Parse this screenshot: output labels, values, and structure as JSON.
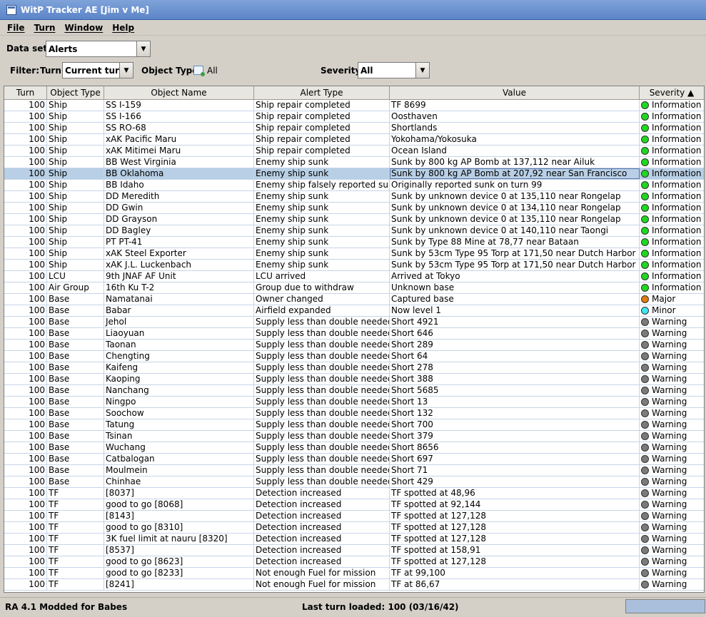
{
  "window": {
    "title": "WitP Tracker AE [Jim v Me]"
  },
  "menu": [
    "File",
    "Turn",
    "Window",
    "Help"
  ],
  "filters": {
    "dataset_label": "Data set:",
    "dataset_value": "Alerts",
    "filter_label": "Filter:",
    "turn_label": "Turn:",
    "turn_value": "Current turn",
    "object_type_label": "Object Type:",
    "object_type_value": "All",
    "severity_label": "Severity:",
    "severity_value": "All"
  },
  "table": {
    "columns": [
      "Turn",
      "Object Type",
      "Object Name",
      "Alert Type",
      "Value",
      "Severity ▲"
    ],
    "severity_colors": {
      "Information": "#1fd81f",
      "Major": "#e07b10",
      "Minor": "#3ee6f0",
      "Warning": "#7b7b7b"
    },
    "rows": [
      [
        "100",
        "Ship",
        "SS I-159",
        "Ship repair completed",
        "TF 8699",
        "Information"
      ],
      [
        "100",
        "Ship",
        "SS I-166",
        "Ship repair completed",
        "Oosthaven",
        "Information"
      ],
      [
        "100",
        "Ship",
        "SS RO-68",
        "Ship repair completed",
        "Shortlands",
        "Information"
      ],
      [
        "100",
        "Ship",
        "xAK Pacific Maru",
        "Ship repair completed",
        "Yokohama/Yokosuka",
        "Information"
      ],
      [
        "100",
        "Ship",
        "xAK Mitimei Maru",
        "Ship repair completed",
        "Ocean Island",
        "Information"
      ],
      [
        "100",
        "Ship",
        "BB West Virginia",
        "Enemy ship sunk",
        "Sunk by 800 kg AP Bomb at 137,112 near Ailuk",
        "Information"
      ],
      [
        "100",
        "Ship",
        "BB Oklahoma",
        "Enemy ship sunk",
        "Sunk by 800 kg AP Bomb at 207,92 near San Francisco",
        "Information"
      ],
      [
        "100",
        "Ship",
        "BB Idaho",
        "Enemy ship falsely reported sunk",
        "Originally reported sunk on turn 99",
        "Information"
      ],
      [
        "100",
        "Ship",
        "DD Meredith",
        "Enemy ship sunk",
        "Sunk by unknown device 0 at 135,110 near Rongelap",
        "Information"
      ],
      [
        "100",
        "Ship",
        "DD Gwin",
        "Enemy ship sunk",
        "Sunk by unknown device 0 at 134,110 near Rongelap",
        "Information"
      ],
      [
        "100",
        "Ship",
        "DD Grayson",
        "Enemy ship sunk",
        "Sunk by unknown device 0 at 135,110 near Rongelap",
        "Information"
      ],
      [
        "100",
        "Ship",
        "DD Bagley",
        "Enemy ship sunk",
        "Sunk by unknown device 0 at 140,110 near Taongi",
        "Information"
      ],
      [
        "100",
        "Ship",
        "PT PT-41",
        "Enemy ship sunk",
        "Sunk by Type 88 Mine at 78,77 near Bataan",
        "Information"
      ],
      [
        "100",
        "Ship",
        "xAK Steel Exporter",
        "Enemy ship sunk",
        "Sunk by 53cm Type 95 Torp at 171,50 near Dutch Harbor",
        "Information"
      ],
      [
        "100",
        "Ship",
        "xAK J.L. Luckenbach",
        "Enemy ship sunk",
        "Sunk by 53cm Type 95 Torp at 171,50 near Dutch Harbor",
        "Information"
      ],
      [
        "100",
        "LCU",
        "9th JNAF AF Unit",
        "LCU arrived",
        "Arrived at Tokyo",
        "Information"
      ],
      [
        "100",
        "Air Group",
        "16th Ku T-2",
        "Group due to withdraw",
        "Unknown base",
        "Information"
      ],
      [
        "100",
        "Base",
        "Namatanai",
        "Owner changed",
        "Captured base",
        "Major"
      ],
      [
        "100",
        "Base",
        "Babar",
        "Airfield expanded",
        "Now level 1",
        "Minor"
      ],
      [
        "100",
        "Base",
        "Jehol",
        "Supply less than double needed",
        "Short 4921",
        "Warning"
      ],
      [
        "100",
        "Base",
        "Liaoyuan",
        "Supply less than double needed",
        "Short 646",
        "Warning"
      ],
      [
        "100",
        "Base",
        "Taonan",
        "Supply less than double needed",
        "Short 289",
        "Warning"
      ],
      [
        "100",
        "Base",
        "Chengting",
        "Supply less than double needed",
        "Short 64",
        "Warning"
      ],
      [
        "100",
        "Base",
        "Kaifeng",
        "Supply less than double needed",
        "Short 278",
        "Warning"
      ],
      [
        "100",
        "Base",
        "Kaoping",
        "Supply less than double needed",
        "Short 388",
        "Warning"
      ],
      [
        "100",
        "Base",
        "Nanchang",
        "Supply less than double needed",
        "Short 5685",
        "Warning"
      ],
      [
        "100",
        "Base",
        "Ningpo",
        "Supply less than double needed",
        "Short 13",
        "Warning"
      ],
      [
        "100",
        "Base",
        "Soochow",
        "Supply less than double needed",
        "Short 132",
        "Warning"
      ],
      [
        "100",
        "Base",
        "Tatung",
        "Supply less than double needed",
        "Short 700",
        "Warning"
      ],
      [
        "100",
        "Base",
        "Tsinan",
        "Supply less than double needed",
        "Short 379",
        "Warning"
      ],
      [
        "100",
        "Base",
        "Wuchang",
        "Supply less than double needed",
        "Short 8656",
        "Warning"
      ],
      [
        "100",
        "Base",
        "Catbalogan",
        "Supply less than double needed",
        "Short 697",
        "Warning"
      ],
      [
        "100",
        "Base",
        "Moulmein",
        "Supply less than double needed",
        "Short 71",
        "Warning"
      ],
      [
        "100",
        "Base",
        "Chinhae",
        "Supply less than double needed",
        "Short 429",
        "Warning"
      ],
      [
        "100",
        "TF",
        " [8037]",
        "Detection increased",
        "TF spotted at 48,96",
        "Warning"
      ],
      [
        "100",
        "TF",
        "good to go [8068]",
        "Detection increased",
        "TF spotted at 92,144",
        "Warning"
      ],
      [
        "100",
        "TF",
        " [8143]",
        "Detection increased",
        "TF spotted at 127,128",
        "Warning"
      ],
      [
        "100",
        "TF",
        "good to go [8310]",
        "Detection increased",
        "TF spotted at 127,128",
        "Warning"
      ],
      [
        "100",
        "TF",
        "3K fuel limit at nauru [8320]",
        "Detection increased",
        "TF spotted at 127,128",
        "Warning"
      ],
      [
        "100",
        "TF",
        " [8537]",
        "Detection increased",
        "TF spotted at 158,91",
        "Warning"
      ],
      [
        "100",
        "TF",
        "good to go [8623]",
        "Detection increased",
        "TF spotted at 127,128",
        "Warning"
      ],
      [
        "100",
        "TF",
        "good to go [8233]",
        "Not enough Fuel for mission",
        "TF at 99,100",
        "Warning"
      ],
      [
        "100",
        "TF",
        " [8241]",
        "Not enough Fuel for mission",
        "TF at 86,67",
        "Warning"
      ]
    ],
    "selected_row": 6
  },
  "status": {
    "left": "RA 4.1 Modded for Babes",
    "mid": "Last turn loaded: 100 (03/16/42)"
  }
}
